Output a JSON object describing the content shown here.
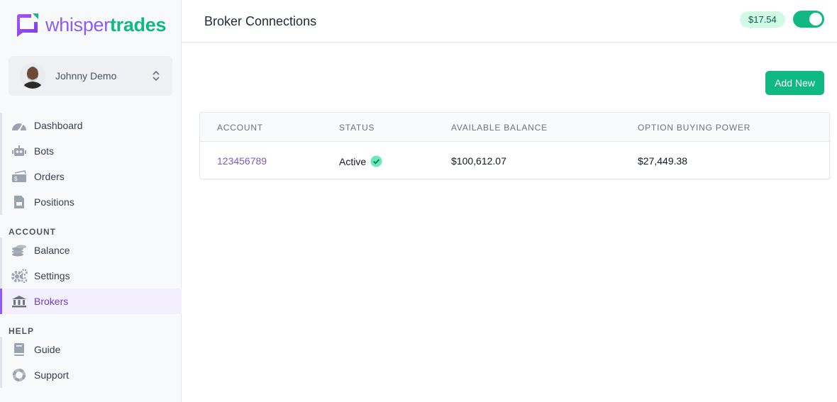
{
  "brand": {
    "part1": "whisper",
    "part2": "trades",
    "colors": {
      "purple": "#8b5cf6",
      "green": "#10b981"
    }
  },
  "user": {
    "name": "Johnny Demo"
  },
  "nav": {
    "main": [
      {
        "label": "Dashboard",
        "icon": "gauge-icon"
      },
      {
        "label": "Bots",
        "icon": "robot-icon"
      },
      {
        "label": "Orders",
        "icon": "ticket-icon"
      },
      {
        "label": "Positions",
        "icon": "document-icon"
      }
    ],
    "account_label": "ACCOUNT",
    "account": [
      {
        "label": "Balance",
        "icon": "coins-icon"
      },
      {
        "label": "Settings",
        "icon": "gears-icon"
      },
      {
        "label": "Brokers",
        "icon": "bank-icon",
        "active": true
      }
    ],
    "help_label": "HELP",
    "help": [
      {
        "label": "Guide",
        "icon": "book-icon"
      },
      {
        "label": "Support",
        "icon": "lifebuoy-icon"
      }
    ]
  },
  "header": {
    "title": "Broker Connections",
    "balance": "$17.54",
    "toggle_on": true
  },
  "actions": {
    "add_new": "Add New"
  },
  "table": {
    "columns": [
      "ACCOUNT",
      "STATUS",
      "AVAILABLE BALANCE",
      "OPTION BUYING POWER"
    ],
    "rows": [
      {
        "account": "123456789",
        "status": "Active",
        "available_balance": "$100,612.07",
        "option_buying_power": "$27,449.38"
      }
    ]
  }
}
